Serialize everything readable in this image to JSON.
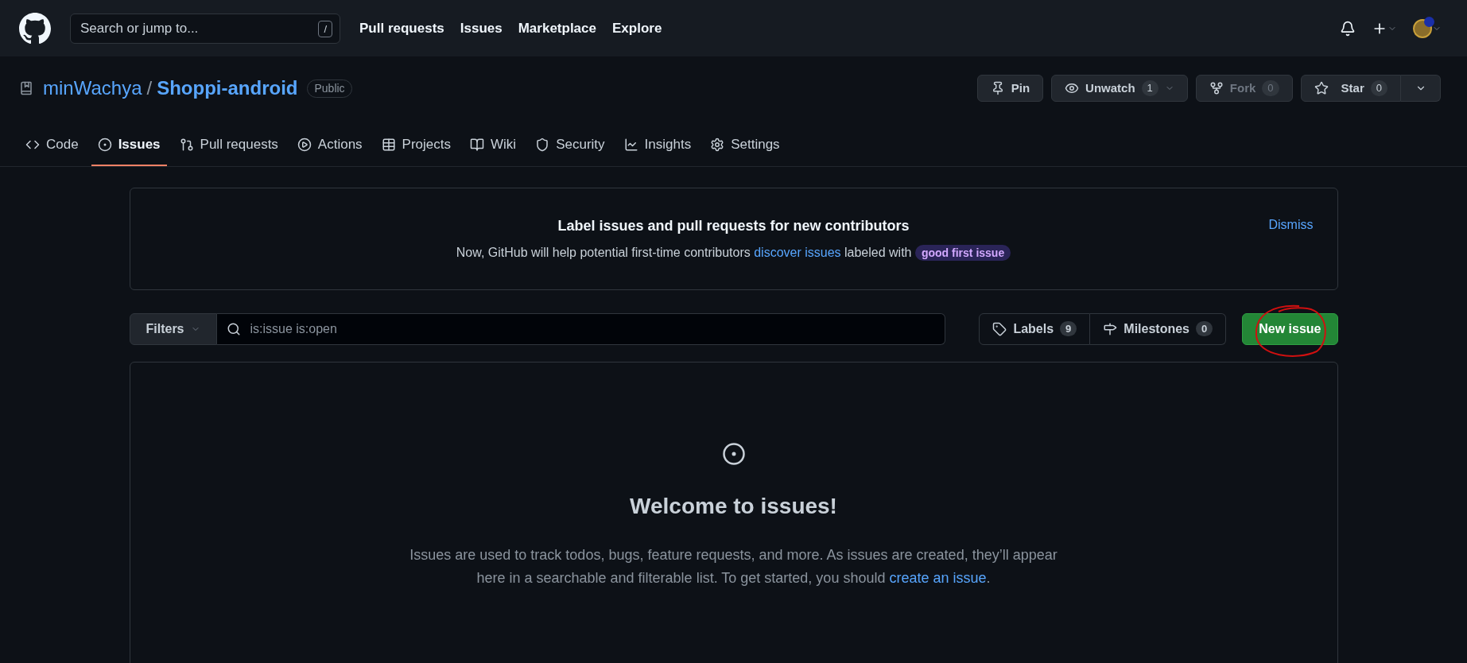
{
  "header": {
    "search_placeholder": "Search or jump to...",
    "search_key": "/",
    "nav": [
      "Pull requests",
      "Issues",
      "Marketplace",
      "Explore"
    ]
  },
  "repo": {
    "owner": "minWachya",
    "separator": "/",
    "name": "Shoppi-android",
    "visibility": "Public",
    "actions": [
      {
        "kind": "pin",
        "label": "Pin",
        "disabled": false
      },
      {
        "kind": "watch",
        "label": "Unwatch",
        "count": "1",
        "disabled": false
      },
      {
        "kind": "fork",
        "label": "Fork",
        "count": "0",
        "disabled": true
      },
      {
        "kind": "star",
        "label": "Star",
        "count": "0",
        "disabled": false
      }
    ]
  },
  "tabs": [
    {
      "label": "Code",
      "selected": false
    },
    {
      "label": "Issues",
      "selected": true
    },
    {
      "label": "Pull requests",
      "selected": false
    },
    {
      "label": "Actions",
      "selected": false
    },
    {
      "label": "Projects",
      "selected": false
    },
    {
      "label": "Wiki",
      "selected": false
    },
    {
      "label": "Security",
      "selected": false
    },
    {
      "label": "Insights",
      "selected": false
    },
    {
      "label": "Settings",
      "selected": false
    }
  ],
  "banner": {
    "title": "Label issues and pull requests for new contributors",
    "text_before": "Now, GitHub will help potential first-time contributors ",
    "link": "discover issues",
    "text_after": " labeled with ",
    "label": "good first issue",
    "dismiss": "Dismiss"
  },
  "filters": {
    "button": "Filters",
    "search_value": "is:issue is:open",
    "labels": {
      "label": "Labels",
      "count": "9"
    },
    "milestones": {
      "label": "Milestones",
      "count": "0"
    },
    "new_issue": "New issue"
  },
  "empty_state": {
    "title": "Welcome to issues!",
    "text_before": "Issues are used to track todos, bugs, feature requests, and more. As issues are created, they’ll appear here in a searchable and filterable list. To get started, you should ",
    "link": "create an issue",
    "text_after": "."
  }
}
